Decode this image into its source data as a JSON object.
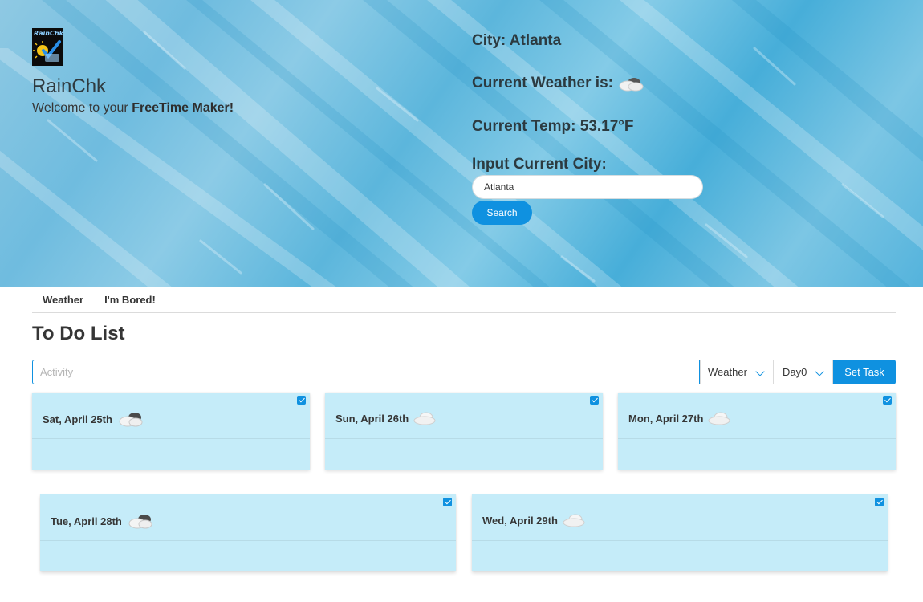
{
  "hero": {
    "logo_text": "RainChk",
    "title": "RainChk",
    "subtitle_prefix": "Welcome to your ",
    "subtitle_bold": "FreeTime Maker!",
    "city_line": "City: Atlanta",
    "weather_line": "Current Weather is:",
    "weather_icon": "cloud-sun-icon",
    "temp_line": "Current Temp: 53.17°F",
    "input_label": "Input Current City:",
    "city_input_value": "Atlanta",
    "search_label": "Search"
  },
  "tabs": [
    "Weather",
    "I'm Bored!"
  ],
  "todo": {
    "title": "To Do List",
    "activity_placeholder": "Activity",
    "weather_select": "Weather",
    "day_select": "Day0",
    "set_task_label": "Set Task"
  },
  "forecast": [
    {
      "date": "Sat, April 25th",
      "icon": "dark-cloud-icon",
      "checked": true
    },
    {
      "date": "Sun, April 26th",
      "icon": "cloud-icon",
      "checked": true
    },
    {
      "date": "Mon, April 27th",
      "icon": "cloud-icon",
      "checked": true
    },
    {
      "date": "Tue, April 28th",
      "icon": "dark-cloud-icon",
      "checked": true
    },
    {
      "date": "Wed, April 29th",
      "icon": "cloud-icon",
      "checked": true
    }
  ],
  "colors": {
    "accent": "#0f91e0",
    "card_bg": "#c5ecf9",
    "hero_bg": "#6fbcdf"
  }
}
